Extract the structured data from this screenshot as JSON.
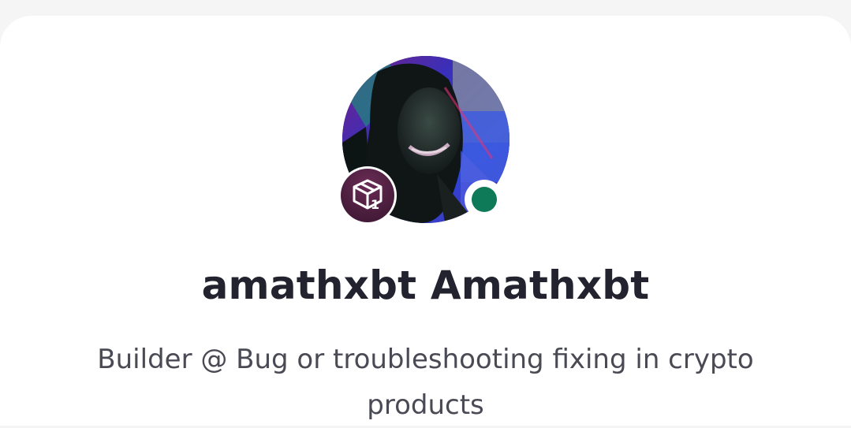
{
  "profile": {
    "display_name": "amathxbt Amathxbt",
    "bio": "Builder @ Bug or troubleshooting fixing in crypto products",
    "avatar_icon": "user-photo",
    "badge": {
      "icon": "cube-icon",
      "count": "1",
      "color": "#4b1e3e"
    },
    "status": {
      "state": "online",
      "color": "#0f7a57"
    }
  }
}
